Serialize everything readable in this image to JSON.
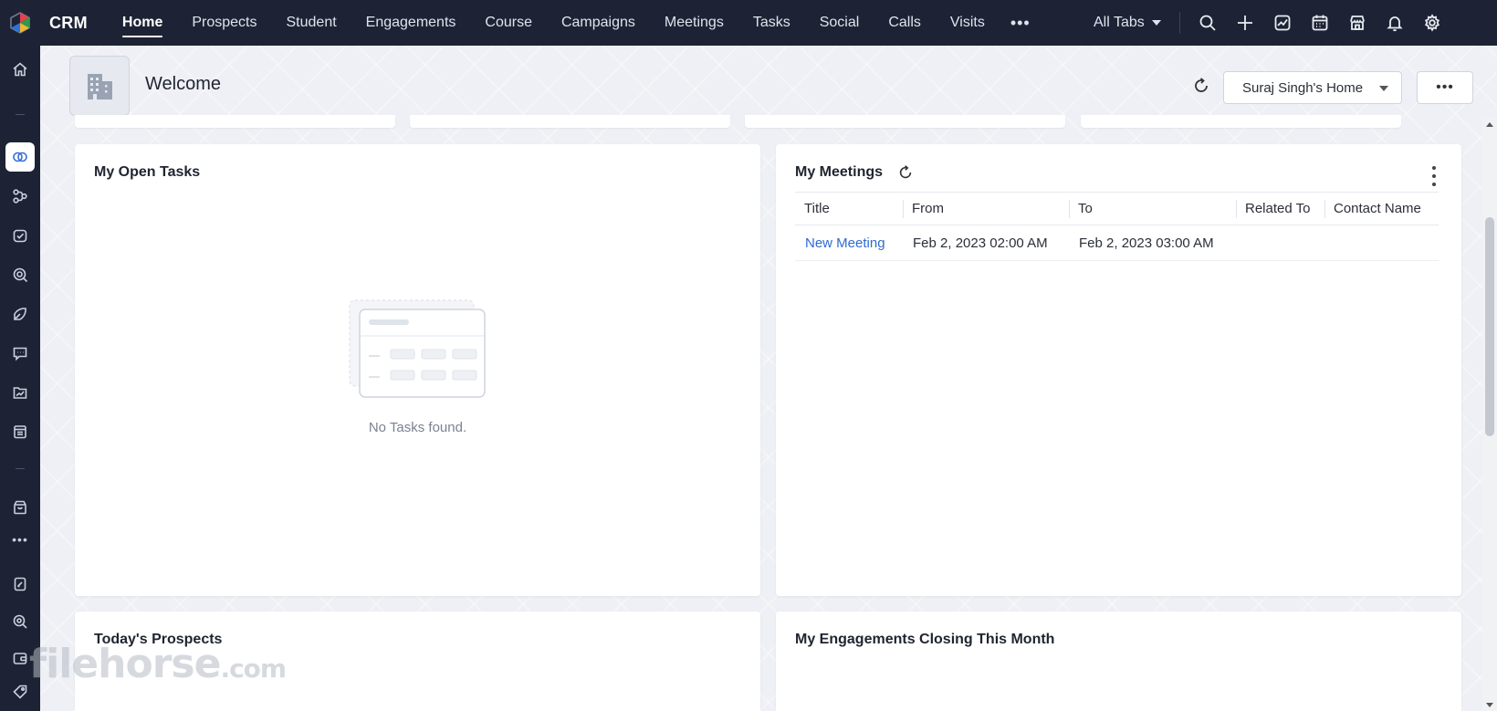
{
  "app": {
    "brand": "CRM"
  },
  "nav": {
    "items": [
      {
        "label": "Home",
        "active": true
      },
      {
        "label": "Prospects"
      },
      {
        "label": "Student"
      },
      {
        "label": "Engagements"
      },
      {
        "label": "Course"
      },
      {
        "label": "Campaigns"
      },
      {
        "label": "Meetings"
      },
      {
        "label": "Tasks"
      },
      {
        "label": "Social"
      },
      {
        "label": "Calls"
      },
      {
        "label": "Visits"
      }
    ],
    "more_label": "•••",
    "all_tabs_label": "All Tabs"
  },
  "top_icons": [
    "search-icon",
    "add-icon",
    "analytics-icon",
    "calendar-icon",
    "marketplace-icon",
    "bell-icon",
    "gear-icon"
  ],
  "header": {
    "welcome": "Welcome",
    "home_selector": "Suraj Singh's Home",
    "more_label": "•••"
  },
  "cards": {
    "open_tasks": {
      "title": "My Open Tasks",
      "empty_text": "No Tasks found."
    },
    "meetings": {
      "title": "My Meetings",
      "columns": [
        "Title",
        "From",
        "To",
        "Related To",
        "Contact Name"
      ],
      "rows": [
        {
          "title": "New Meeting",
          "from": "Feb 2, 2023 02:00 AM",
          "to": "Feb 2, 2023 03:00 AM",
          "related_to": "",
          "contact_name": ""
        }
      ]
    },
    "todays_prospects": {
      "title": "Today's Prospects"
    },
    "engagements_closing": {
      "title": "My Engagements Closing This Month"
    }
  },
  "watermark": {
    "main": "filehorse",
    "suffix": ".com"
  },
  "colors": {
    "topbar": "#1d2334",
    "link": "#2e6bd1",
    "accent": "#3b6fd6"
  }
}
